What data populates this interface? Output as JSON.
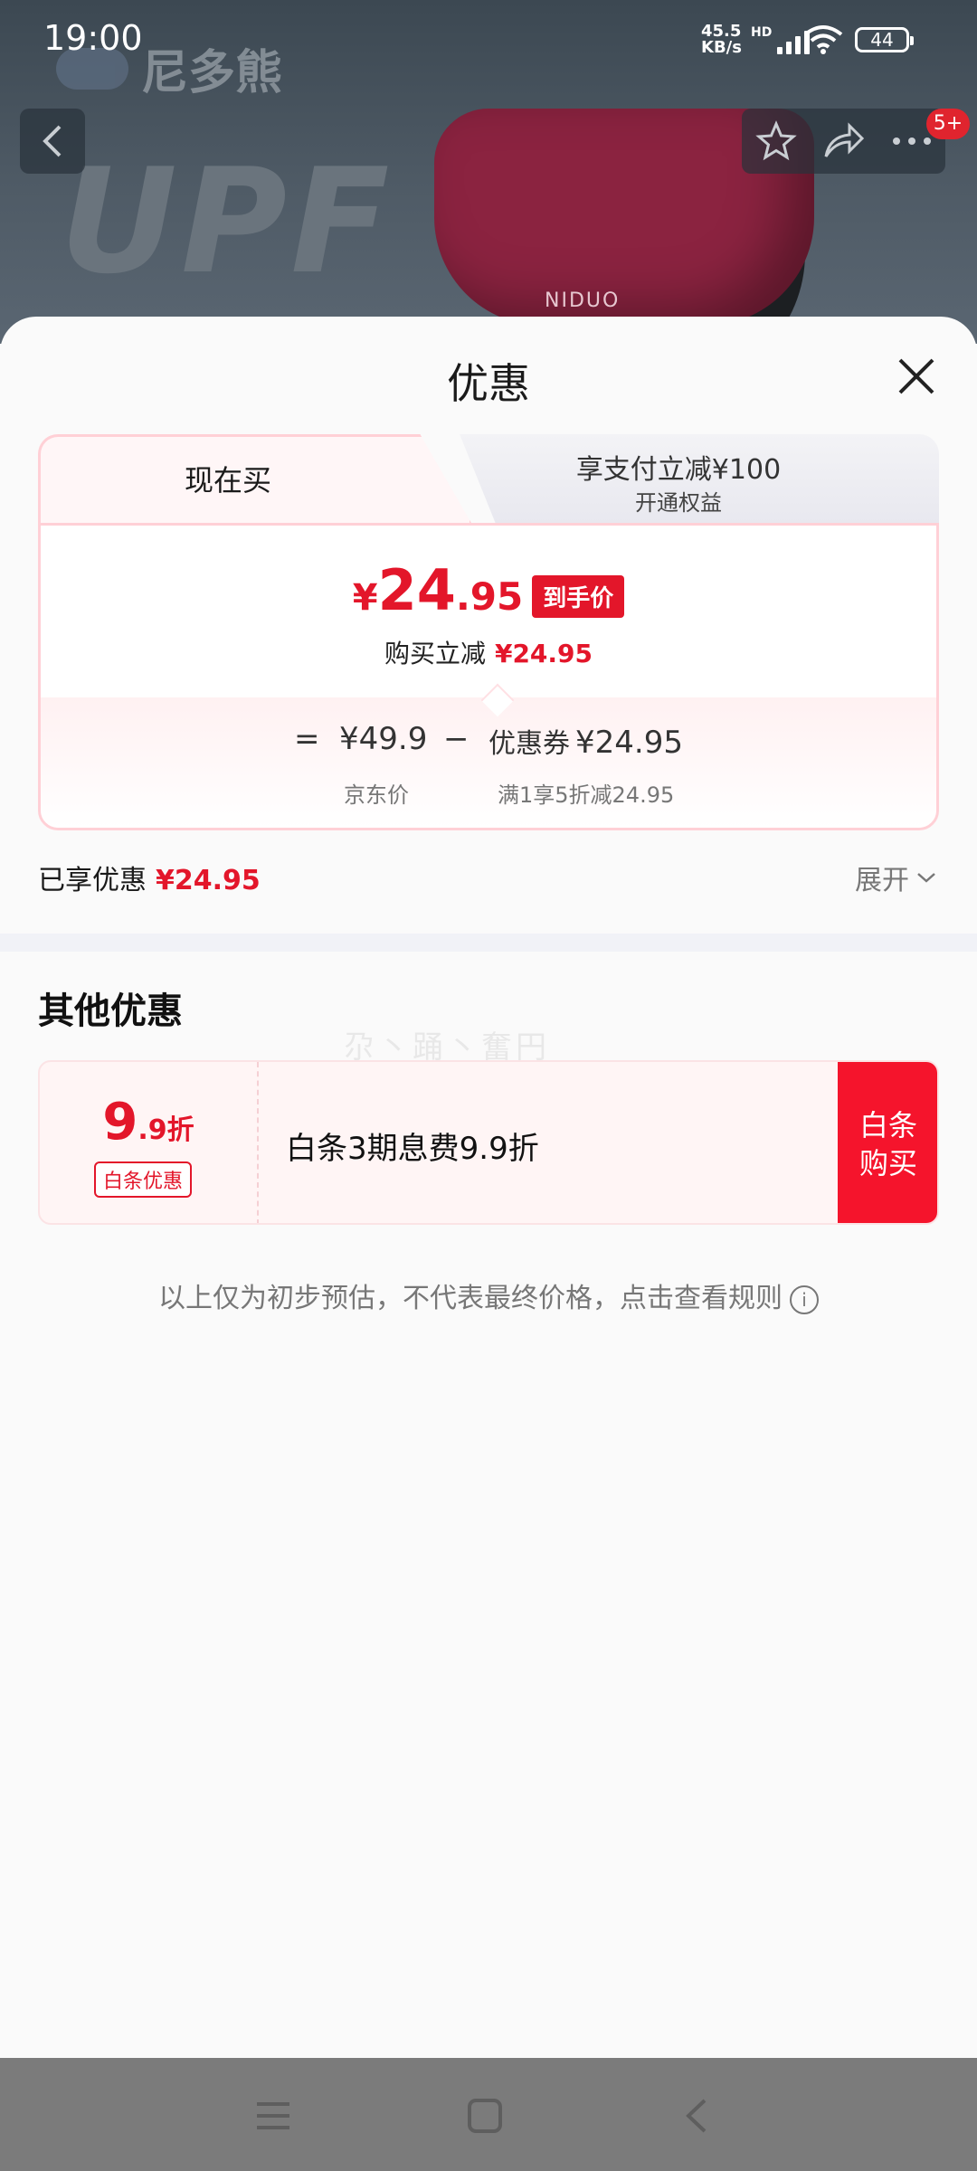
{
  "status_bar": {
    "time": "19:00",
    "net_speed_value": "45.5",
    "net_speed_unit": "KB/s",
    "hd_label": "HD",
    "battery": "44"
  },
  "background": {
    "brand": "尼多熊",
    "hero_text": "UPF",
    "product_label": "NIDUO"
  },
  "top_nav": {
    "back_icon": "chevron-left-icon",
    "favorite_icon": "star-icon",
    "share_icon": "share-arrow-icon",
    "more_icon": "more-dots-icon",
    "badge": "5+"
  },
  "sheet": {
    "title": "优惠",
    "close_icon": "close-icon",
    "tabs": {
      "now": "现在买",
      "pay_title": "享支付立减¥100",
      "pay_sub": "开通权益"
    },
    "price": {
      "currency": "¥",
      "integer": "24",
      "decimal": ".95",
      "final_tag": "到手价",
      "reduce_label": "购买立减",
      "reduce_value": "¥24.95"
    },
    "formula": {
      "equals": "=",
      "jd_price": "¥49.9",
      "minus": "−",
      "coupon_label": "优惠券",
      "coupon_value": "¥24.95",
      "jd_price_label": "京东价",
      "coupon_rule": "满1享5折减24.95"
    },
    "enjoyed": {
      "label": "已享优惠",
      "value": "¥24.95",
      "expand": "展开"
    },
    "other": {
      "title": "其他优惠",
      "watermark": "尕丶踊丶奮円",
      "promo": {
        "rate_big": "9",
        "rate_small": ".9折",
        "tag": "白条优惠",
        "text": "白条3期息费9.9折",
        "button_line1": "白条",
        "button_line2": "购买"
      }
    },
    "disclaimer": "以上仅为初步预估，不代表最终价格，点击查看规则",
    "disclaimer_icon": "info-icon"
  },
  "system_nav": {
    "menu_icon": "menu-icon",
    "home_icon": "home-square-icon",
    "back_icon": "back-chevron-icon"
  },
  "colors": {
    "accent_red": "#e3162a",
    "button_red": "#f5142c"
  }
}
